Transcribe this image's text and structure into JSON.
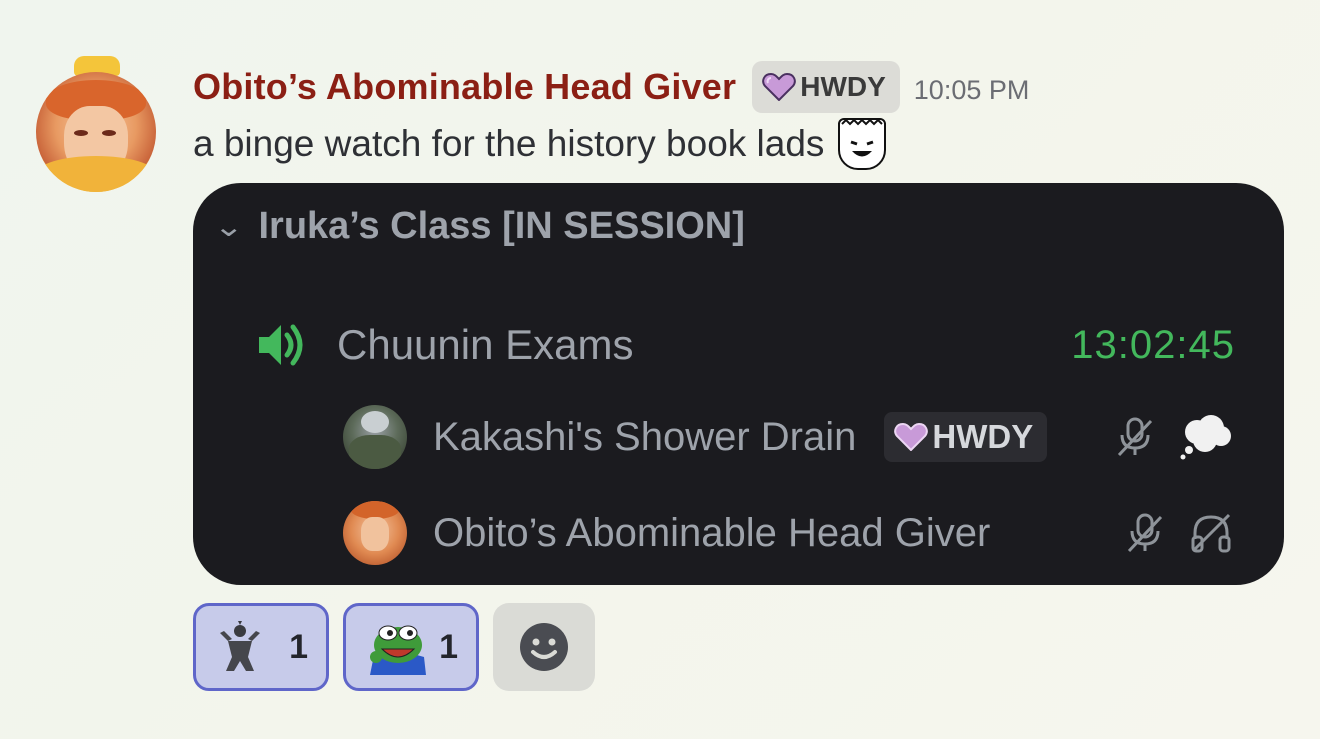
{
  "message": {
    "author": "Obito’s Abominable Head Giver",
    "author_color": "#8b1f14",
    "tag": "HWDY",
    "tag_icon": "heart-icon",
    "timestamp": "10:05 PM",
    "content": "a binge watch for the history book lads",
    "content_emoji": "smirking-face-emoji"
  },
  "embed": {
    "category": "Iruka’s Class [IN SESSION]",
    "channel": {
      "icon": "speaker-icon",
      "name": "Chuunin Exams",
      "elapsed": "13:02:45",
      "elapsed_color": "#43b85c"
    },
    "members": [
      {
        "name": "Kakashi's Shower Drain",
        "tag": "HWDY",
        "icons": [
          "muted-mic-icon",
          "thought-bubble-icon"
        ]
      },
      {
        "name": "Obito’s Abominable Head Giver",
        "tag": "",
        "icons": [
          "muted-mic-icon",
          "deafened-headphones-icon"
        ]
      }
    ]
  },
  "reactions": [
    {
      "emoji": "warrior-statue-emoji",
      "count": "1"
    },
    {
      "emoji": "pepe-frog-emoji",
      "count": "1"
    }
  ],
  "add_reaction_icon": "add-reaction-icon"
}
